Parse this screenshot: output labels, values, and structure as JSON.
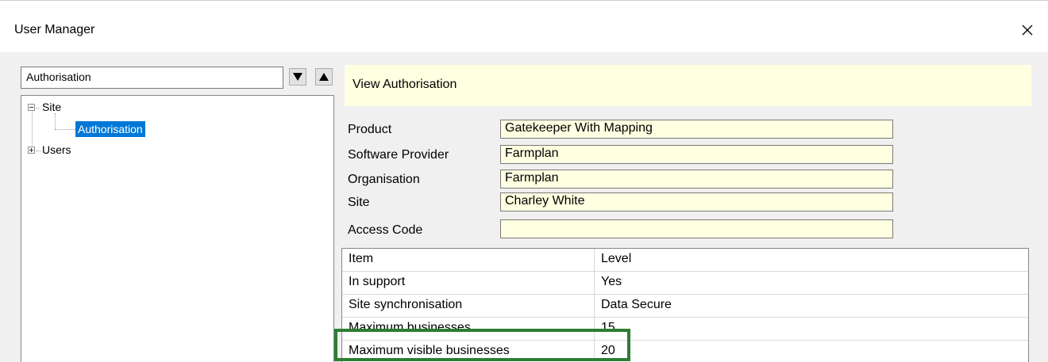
{
  "window": {
    "title": "User Manager",
    "close_icon": "close-icon"
  },
  "left": {
    "combo_value": "Authorisation",
    "tree": [
      {
        "label": "Site",
        "expanded": true
      },
      {
        "label": "Authorisation",
        "selected": true
      },
      {
        "label": "Users",
        "expanded": false
      }
    ]
  },
  "right": {
    "header": "View Authorisation",
    "fields": [
      {
        "label": "Product",
        "value": "Gatekeeper With Mapping"
      },
      {
        "label": "Software Provider",
        "value": "Farmplan"
      },
      {
        "label": "Organisation",
        "value": "Farmplan"
      },
      {
        "label": "Site",
        "value": "Charley White"
      },
      {
        "label": "Access Code",
        "value": ""
      }
    ],
    "grid": {
      "columns": [
        "Item",
        "Level"
      ],
      "rows": [
        [
          "In support",
          "Yes"
        ],
        [
          "Site synchronisation",
          "Data Secure"
        ],
        [
          "Maximum businesses",
          "15"
        ],
        [
          "Maximum visible businesses",
          "20"
        ]
      ]
    }
  },
  "colors": {
    "highlight": "#2e7d32",
    "info_background": "#ffffe1",
    "selection": "#0078d7"
  }
}
